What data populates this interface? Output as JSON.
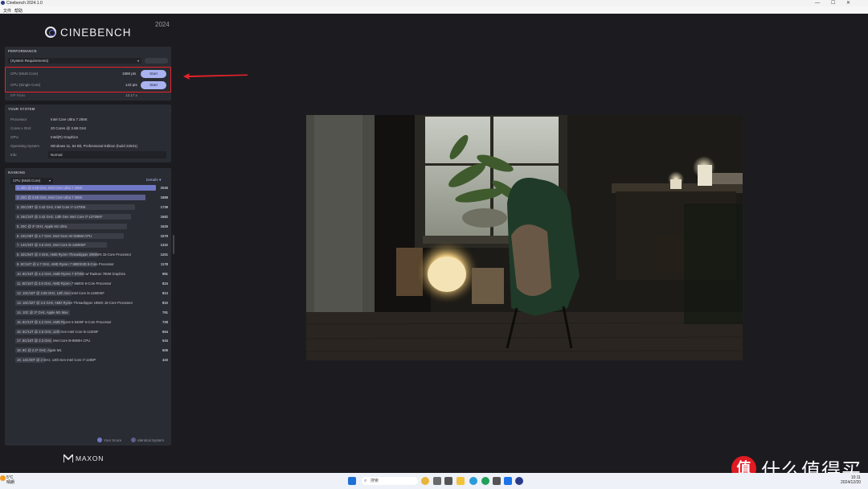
{
  "window": {
    "title": "Cinebench 2024.1.0",
    "menu": [
      "文件",
      "帮助"
    ]
  },
  "brand": {
    "name": "CINEBENCH",
    "year": "2024",
    "footer": "MAXON"
  },
  "performance": {
    "header": "PERFORMANCE",
    "preset": "(System Requirements)",
    "multi": {
      "label": "CPU (Multi Core)",
      "score": "1888 pts",
      "button": "Start"
    },
    "single": {
      "label": "CPU (Single Core)",
      "score": "143 pts",
      "button": "Start"
    },
    "mp_ratio": {
      "label": "MP Ratio",
      "value": "13.17 x"
    }
  },
  "system": {
    "header": "YOUR SYSTEM",
    "rows": [
      {
        "label": "Processor",
        "value": "Intel Core Ultra 7 265K"
      },
      {
        "label": "Cores x GHz",
        "value": "20 Cores @ 3.88 GHz"
      },
      {
        "label": "GPU",
        "value": "Intel(R) Graphics"
      },
      {
        "label": "Operating System",
        "value": "Windows 11, 64 Bit, Professional Edition (build 22631)"
      },
      {
        "label": "Info",
        "value": "Normal"
      }
    ]
  },
  "ranking": {
    "header": "RANKING",
    "filter": "CPU (Multi Core)",
    "details": "Details",
    "max_score": 2045,
    "entries": [
      {
        "label": "1. 20C @ 3.88 GHz, Intel Core Ultra 7 265K",
        "score": 2045,
        "kind": "you"
      },
      {
        "label": "2. 20C @ 3.88 GHz, Intel Core Ultra 7 265K",
        "score": 1888,
        "kind": "ident"
      },
      {
        "label": "3. 20C/28T @ 3.42 GHz, Intel Core i7-14700K",
        "score": 1739,
        "kind": "other"
      },
      {
        "label": "4. 16C/24T @ 3.42 GHz, 13th Gen Intel Core i7-13700KF",
        "score": 1682,
        "kind": "other"
      },
      {
        "label": "5. 20C @ 3* GHz, Apple M1 Ultra",
        "score": 1625,
        "kind": "other"
      },
      {
        "label": "6. 24C/48T @ 2.7 GHz, Intel Xeon W-3265M CPU",
        "score": 1579,
        "kind": "other"
      },
      {
        "label": "7. 14C/20T @ 3.5 GHz, Intel Core i5-14600KF",
        "score": 1332,
        "kind": "other"
      },
      {
        "label": "8. 32C/64T @ 3 GHz, AMD Ryzen Threadripper 2990WX 32-Core Processor",
        "score": 1201,
        "kind": "other"
      },
      {
        "label": "9. 8C/16T @ 4.7 GHz, AMD Ryzen 7 9800X3D 8-Core Processor",
        "score": 1178,
        "kind": "other"
      },
      {
        "label": "10. 8C/16T @ 4.2 GHz, AMD Ryzen 7 8700G w/ Radeon 780M Graphics",
        "score": 991,
        "kind": "other"
      },
      {
        "label": "11. 8C/16T @ 3.8 GHz, AMD Ryzen 7 5800X 8-Core Processor",
        "score": 824,
        "kind": "other"
      },
      {
        "label": "12. 10C/16T @ 3.69 GHz, 12th Gen Intel Core i5-12600KF",
        "score": 813,
        "kind": "other"
      },
      {
        "label": "13. 16C/32T @ 3.4 GHz, AMD Ryzen Threadripper 1950X 16-Core Processor",
        "score": 810,
        "kind": "other"
      },
      {
        "label": "14. 10C @ 3* GHz, Apple M1 Max",
        "score": 791,
        "kind": "other"
      },
      {
        "label": "15. 6C/12T @ 4.2 GHz, AMD Ryzen 5 8400F 6-Core Processor",
        "score": 728,
        "kind": "other"
      },
      {
        "label": "16. 6C/12T @ 2.5 GHz, 12th Gen Intel Core i5-12400F",
        "score": 654,
        "kind": "other"
      },
      {
        "label": "17. 8C/16T @ 2.3 GHz, Intel Core i9-9880H CPU",
        "score": 534,
        "kind": "other"
      },
      {
        "label": "18. 8C @ 2.3* GHz, Apple M1",
        "score": 509,
        "kind": "other"
      },
      {
        "label": "19. 14C/20T @ 2 GHz, 12th Gen Intel Core i7-1280P",
        "score": 433,
        "kind": "other"
      }
    ],
    "legend": {
      "you": "Your Score",
      "ident": "Identical System"
    }
  },
  "taskbar": {
    "weather_temp": "5°C",
    "weather_desc": "晴朗",
    "search": "搜索",
    "time": "10:11",
    "date": "2024/12/20"
  },
  "watermark": {
    "badge": "值",
    "text": "什么值得买"
  },
  "colors": {
    "accent": "#a9b3ef",
    "your_score": "#7078c8",
    "identical": "#5a5f8c",
    "highlight": "#e8232a"
  }
}
